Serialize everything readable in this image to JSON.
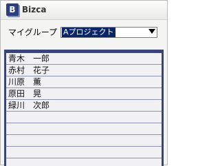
{
  "app": {
    "logo_letter": "B",
    "title": "Bizca"
  },
  "group": {
    "label": "マイグループ",
    "selected": "Aプロジェクト"
  },
  "members": [
    "青木　一郎",
    "赤村　花子",
    "川原　薫",
    "原田　晃",
    "緑川　次郎",
    "",
    "",
    "",
    ""
  ]
}
